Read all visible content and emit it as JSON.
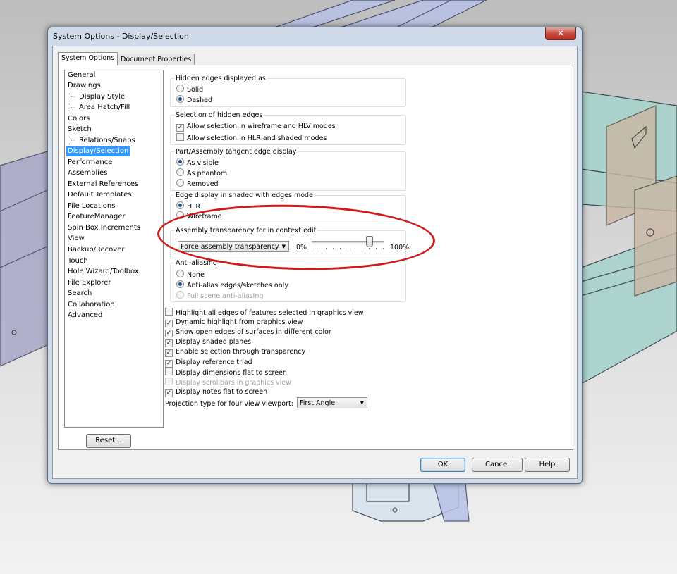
{
  "window": {
    "title": "System Options - Display/Selection",
    "close_icon": "close-icon"
  },
  "tabs": [
    {
      "label": "System Options",
      "active": true
    },
    {
      "label": "Document Properties",
      "active": false
    }
  ],
  "nav": {
    "items": [
      {
        "label": "General"
      },
      {
        "label": "Drawings"
      },
      {
        "label": "Display Style"
      },
      {
        "label": "Area Hatch/Fill"
      },
      {
        "label": "Colors"
      },
      {
        "label": "Sketch"
      },
      {
        "label": "Relations/Snaps"
      },
      {
        "label": "Display/Selection",
        "selected": true
      },
      {
        "label": "Performance"
      },
      {
        "label": "Assemblies"
      },
      {
        "label": "External References"
      },
      {
        "label": "Default Templates"
      },
      {
        "label": "File Locations"
      },
      {
        "label": "FeatureManager"
      },
      {
        "label": "Spin Box Increments"
      },
      {
        "label": "View"
      },
      {
        "label": "Backup/Recover"
      },
      {
        "label": "Touch"
      },
      {
        "label": "Hole Wizard/Toolbox"
      },
      {
        "label": "File Explorer"
      },
      {
        "label": "Search"
      },
      {
        "label": "Collaboration"
      },
      {
        "label": "Advanced"
      }
    ],
    "reset_label": "Reset..."
  },
  "groups": {
    "hidden_edges": {
      "title": "Hidden edges displayed as",
      "options": [
        "Solid",
        "Dashed"
      ],
      "selected": "Dashed"
    },
    "selection_hidden": {
      "title": "Selection of hidden edges",
      "options": [
        {
          "label": "Allow selection in wireframe and HLV modes",
          "checked": true
        },
        {
          "label": "Allow selection in HLR and shaded modes",
          "checked": false
        }
      ]
    },
    "tangent_edge": {
      "title": "Part/Assembly tangent edge display",
      "options": [
        "As visible",
        "As phantom",
        "Removed"
      ],
      "selected": "As visible"
    },
    "edge_display": {
      "title": "Edge display in shaded with edges mode",
      "options": [
        "HLR",
        "Wireframe"
      ],
      "selected": "HLR"
    },
    "assembly_transparency": {
      "title": "Assembly transparency for in context edit",
      "combo_value": "Force assembly transparency",
      "min_label": "0%",
      "max_label": "100%",
      "slider_value": 0.9
    },
    "anti_aliasing": {
      "title": "Anti-aliasing",
      "options": [
        {
          "label": "None",
          "enabled": true
        },
        {
          "label": "Anti-alias edges/sketches only",
          "enabled": true
        },
        {
          "label": "Full scene anti-aliasing",
          "enabled": false
        }
      ],
      "selected": "Anti-alias edges/sketches only"
    }
  },
  "checkboxes": [
    {
      "label": "Highlight all edges of features selected in graphics view",
      "checked": false,
      "enabled": true
    },
    {
      "label": "Dynamic highlight from graphics view",
      "checked": true,
      "enabled": true
    },
    {
      "label": "Show open edges of surfaces in different color",
      "checked": true,
      "enabled": true
    },
    {
      "label": "Display shaded planes",
      "checked": true,
      "enabled": true
    },
    {
      "label": "Enable selection through transparency",
      "checked": true,
      "enabled": true
    },
    {
      "label": "Display reference triad",
      "checked": true,
      "enabled": true
    },
    {
      "label": "Display dimensions flat to screen",
      "checked": false,
      "enabled": true
    },
    {
      "label": "Display scrollbars in graphics view",
      "checked": false,
      "enabled": false
    },
    {
      "label": "Display notes flat to screen",
      "checked": true,
      "enabled": true
    }
  ],
  "projection": {
    "label": "Projection type for four view viewport:",
    "value": "First Angle"
  },
  "buttons": {
    "ok": "OK",
    "cancel": "Cancel",
    "help": "Help"
  },
  "colors": {
    "annotation": "#d11a1a",
    "selection": "#3399ff"
  }
}
